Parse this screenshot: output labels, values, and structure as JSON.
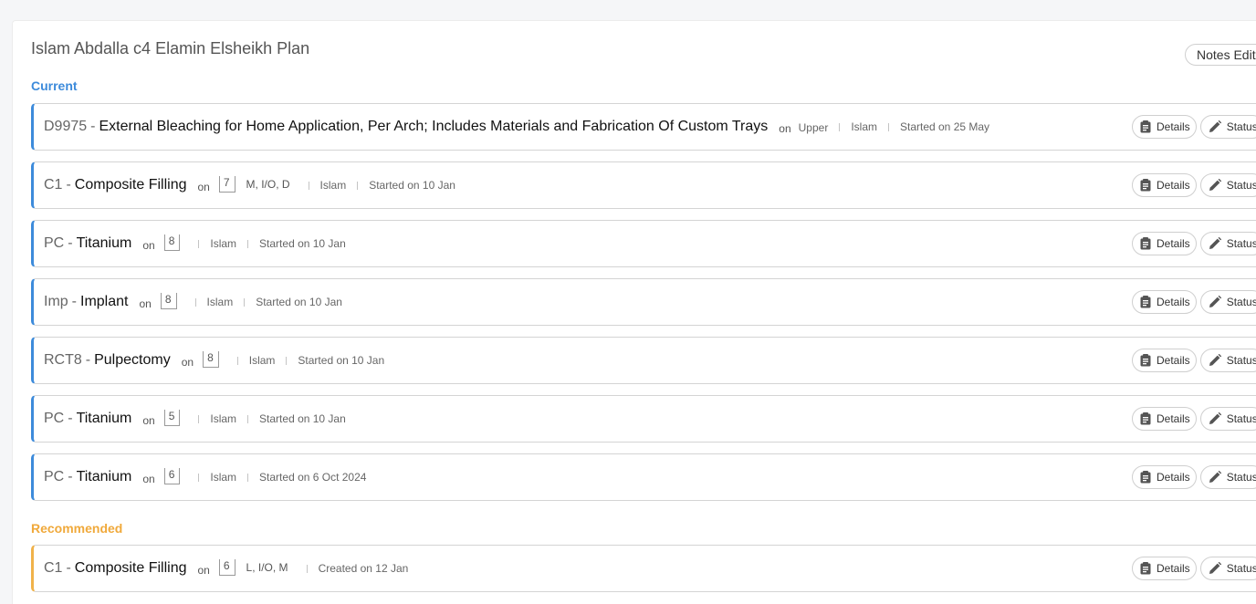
{
  "plan": {
    "title": "Islam Abdalla c4 Elamin Elsheikh Plan",
    "notes_button": "Notes Edite"
  },
  "sections": {
    "current_label": "Current",
    "recommended_label": "Recommended"
  },
  "common": {
    "on_label": "on",
    "details_label": "Details",
    "status_label": "Status"
  },
  "colors": {
    "current_accent": "#3d8bdb",
    "recommended_accent": "#f0b24a"
  },
  "icons": {
    "details": "clipboard-icon",
    "status": "pencil-icon"
  },
  "current_items": [
    {
      "code": "D9975",
      "name": "External Bleaching for Home Application, Per Arch; Includes Materials and Fabrication Of Custom Trays",
      "location": "Upper",
      "provider": "Islam",
      "date": "Started on 25 May"
    },
    {
      "code": "C1",
      "name": "Composite Filling",
      "tooth": "7",
      "surfaces": "M, I/O, D",
      "provider": "Islam",
      "date": "Started on 10 Jan"
    },
    {
      "code": "PC",
      "name": "Titanium",
      "tooth": "8",
      "provider": "Islam",
      "date": "Started on 10 Jan"
    },
    {
      "code": "Imp",
      "name": "Implant",
      "tooth": "8",
      "provider": "Islam",
      "date": "Started on 10 Jan"
    },
    {
      "code": "RCT8",
      "name": "Pulpectomy",
      "tooth": "8",
      "provider": "Islam",
      "date": "Started on 10 Jan"
    },
    {
      "code": "PC",
      "name": "Titanium",
      "tooth": "5",
      "provider": "Islam",
      "date": "Started on 10 Jan"
    },
    {
      "code": "PC",
      "name": "Titanium",
      "tooth": "6",
      "provider": "Islam",
      "date": "Started on 6 Oct 2024"
    }
  ],
  "recommended_items": [
    {
      "code": "C1",
      "name": "Composite Filling",
      "tooth": "6",
      "surfaces": "L, I/O, M",
      "date": "Created on 12 Jan"
    }
  ]
}
